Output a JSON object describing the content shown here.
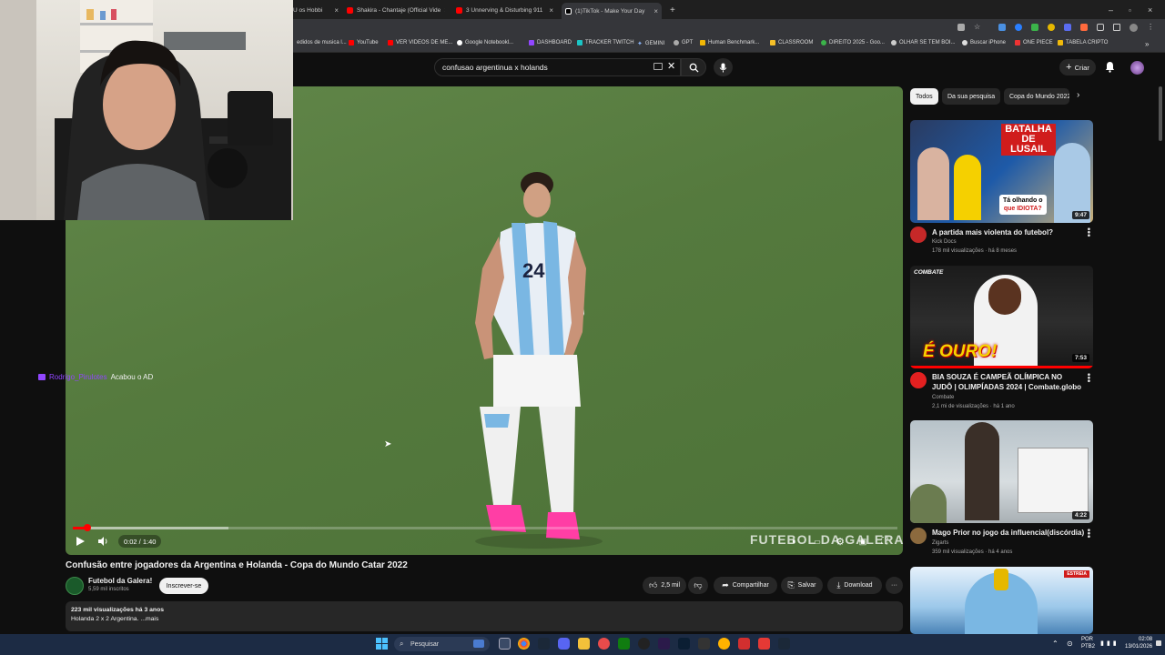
{
  "browser": {
    "tabs": [
      {
        "title": "U os Hobbi",
        "color": "#ff0000"
      },
      {
        "title": "Shakira - Chantaje (Official Vide",
        "color": "#ff0000"
      },
      {
        "title": "3 Unnerving & Disturbing 911",
        "color": "#ff0000"
      },
      {
        "title": "(1)TikTok - Make Your Day",
        "color": "#ffffff"
      }
    ],
    "bookmarks": [
      "edidos de musica l...",
      "YouTube",
      "VER VIDEOS DE ME...",
      "Google Notebookl...",
      "DASHBOARD",
      "TRACKER TWITCH",
      "GEMINI",
      "GPT",
      "Human Benchmark...",
      "CLASSROOM",
      "DIREITO 2025 - Goo...",
      "OLHAR SE TEM BOI...",
      "Buscar iPhone",
      "ONE PIECE",
      "TABELA CRIPTO"
    ]
  },
  "youtube": {
    "search_query": "confusao argentinua x holands",
    "create_label": "Criar"
  },
  "chat": {
    "username": "Rodrigo_Pirulotes",
    "message": "Acabou o AD"
  },
  "player": {
    "time": "0:02 / 1:40",
    "progress_fraction": 0.018,
    "watermark": "FUTEBOL DA GALERA",
    "jersey_number": "24"
  },
  "video": {
    "title": "Confusão entre jogadores da Argentina e Holanda - Copa do Mundo Catar 2022",
    "channel": "Futebol da Galera!",
    "subscribers": "5,59 mil inscritos",
    "subscribe_label": "Inscrever-se",
    "likes": "2,5 mil",
    "share_label": "Compartilhar",
    "save_label": "Salvar",
    "download_label": "Download",
    "views_line": "223 mil visualizações  há 3 anos",
    "description": "Holanda 2 x 2 Argentina. ...mais"
  },
  "filters": [
    "Todos",
    "Da sua pesquisa",
    "Copa do Mundo 2022"
  ],
  "recommendations": [
    {
      "title": "A partida mais violenta do futebol?",
      "channel": "Kick Docs",
      "meta": "178 mil visualizações · há 8 meses",
      "duration": "9:47",
      "overlay_top": "BATALHA DE LUSAIL",
      "overlay_bottom_1": "Tá olhando o",
      "overlay_bottom_2": "que IDIOTA?"
    },
    {
      "title": "BIA SOUZA É CAMPEÃ OLÍMPICA NO JUDÔ | OLIMPÍADAS 2024 | Combate.globo",
      "channel": "Combate",
      "meta": "2,1 mi de visualizações · há 1 ano",
      "duration": "7:53",
      "overlay_top": "COMBATE",
      "overlay_bottom_1": "É OURO!"
    },
    {
      "title": "Mago Prior no jogo da influencial(discórdia)",
      "channel": "Zigarts",
      "meta": "359 mil visualizações · há 4 anos",
      "duration": "4:22"
    },
    {
      "badge": "ESTREIA"
    }
  ],
  "taskbar": {
    "search_label": "Pesquisar",
    "lang_1": "POR",
    "lang_2": "PTB2",
    "time": "02:08",
    "date": "13/01/2026"
  }
}
